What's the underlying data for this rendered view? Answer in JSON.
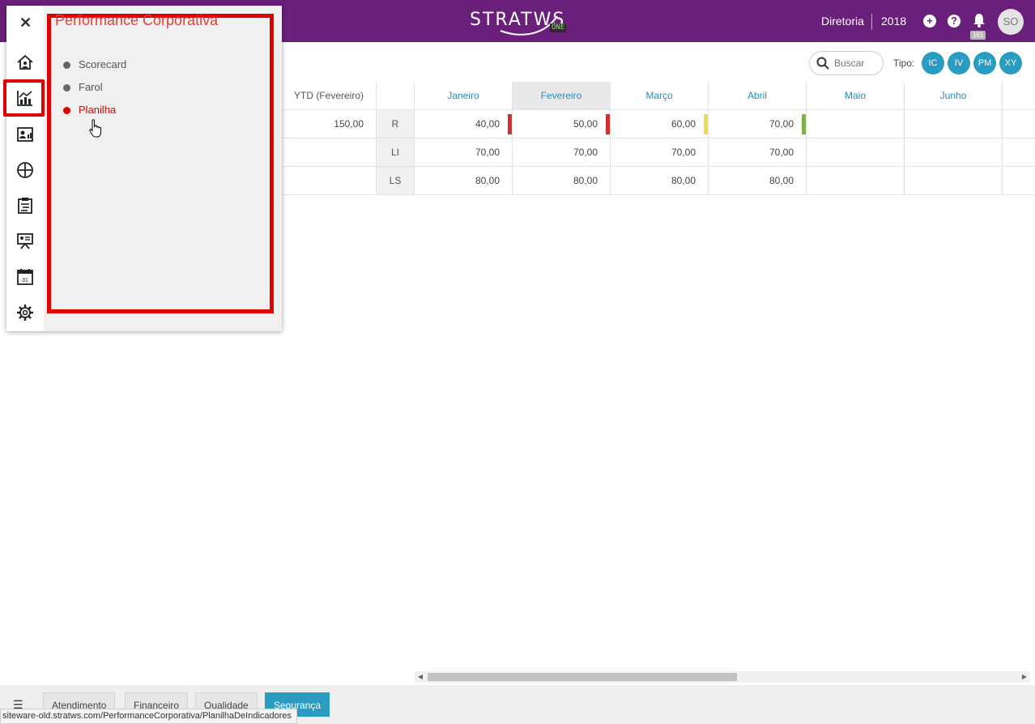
{
  "header": {
    "logo_text": "STRATWS",
    "logo_badge": "ONE",
    "department": "Diretoria",
    "year": "2018",
    "notifications_count": "161",
    "user_initials": "SO",
    "brand_color": "#6a1f7a"
  },
  "toolbar": {
    "search_placeholder": "Buscar",
    "tipo_label": "Tipo:",
    "tipo_buttons": [
      "IC",
      "IV",
      "PM",
      "XY"
    ],
    "accent_color": "#2a9bc1"
  },
  "table": {
    "ytd_header": "YTD (Fevereiro)",
    "months": [
      "Janeiro",
      "Fevereiro",
      "Março",
      "Abril",
      "Maio",
      "Junho"
    ],
    "active_month": "Fevereiro",
    "rows": [
      {
        "ytd": "150,00",
        "label": "R",
        "values": [
          "40,00",
          "50,00",
          "60,00",
          "70,00",
          "",
          ""
        ],
        "flags": [
          "#d32f2f",
          "#d32f2f",
          "#e8e04a",
          "#7cb342"
        ]
      },
      {
        "ytd": "",
        "label": "LI",
        "values": [
          "70,00",
          "70,00",
          "70,00",
          "70,00",
          "",
          ""
        ]
      },
      {
        "ytd": "",
        "label": "LS",
        "values": [
          "80,00",
          "80,00",
          "80,00",
          "80,00",
          "",
          ""
        ]
      }
    ]
  },
  "sidebar": {
    "rail_icons": [
      "close-icon",
      "home-icon",
      "chart-icon",
      "contact-card-icon",
      "target-icon",
      "clipboard-icon",
      "presentation-icon",
      "calendar-icon",
      "gear-icon"
    ],
    "calendar_day": "31",
    "panel_title": "Performance Corporativa",
    "items": [
      {
        "label": "Scorecard",
        "active": false
      },
      {
        "label": "Farol",
        "active": false
      },
      {
        "label": "Planilha",
        "active": true
      }
    ],
    "highlight_color": "#e00000"
  },
  "bottom_tabs": {
    "items": [
      "Atendimento",
      "Financeiro",
      "Qualidade",
      "Segurança"
    ],
    "active": "Segurança"
  },
  "status_url": "siteware-old.stratws.com/PerformanceCorporativa/PlanilhaDeIndicadores"
}
